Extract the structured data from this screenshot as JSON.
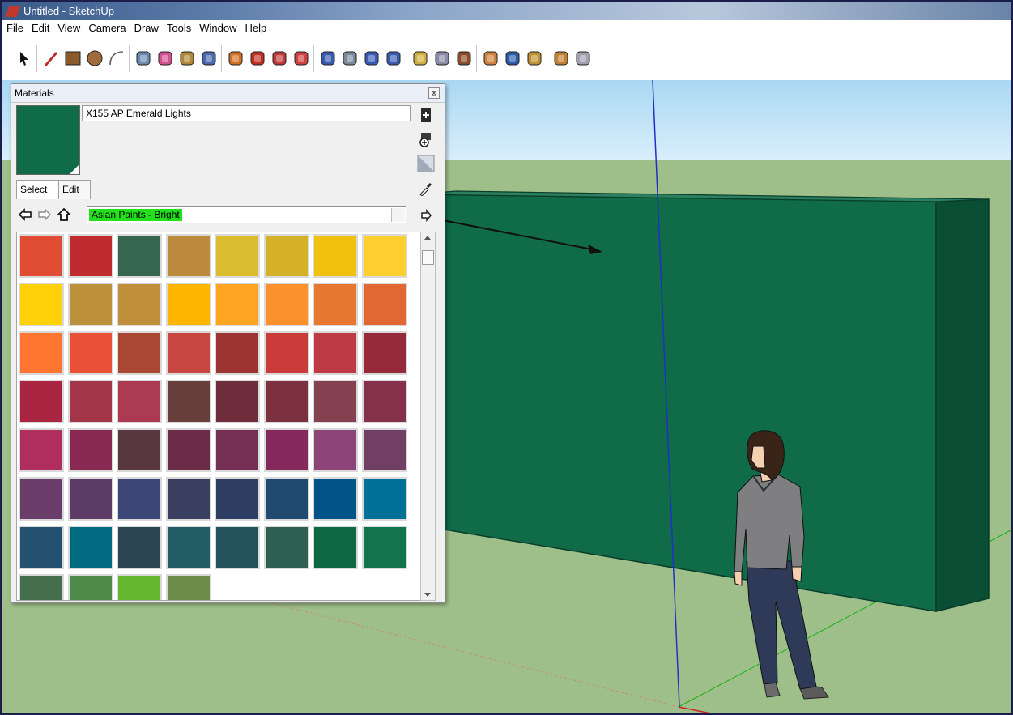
{
  "window": {
    "title": "Untitled - SketchUp"
  },
  "menu": [
    "File",
    "Edit",
    "View",
    "Camera",
    "Draw",
    "Tools",
    "Window",
    "Help"
  ],
  "toolbar": {
    "tools": [
      "select-arrow-icon",
      "pencil-icon",
      "rectangle-icon",
      "circle-icon",
      "arc-icon",
      "make-component-icon",
      "eraser-icon",
      "tape-measure-icon",
      "paint-bucket-icon",
      "push-pull-icon",
      "move-icon",
      "rotate-icon",
      "follow-me-icon",
      "orbit-icon",
      "pan-icon",
      "zoom-icon",
      "zoom-extents-icon",
      "get-models-icon",
      "share-model-icon",
      "components-icon",
      "add-location-icon",
      "google-earth-icon",
      "styles-icon",
      "share-component-icon",
      "photo-textures-icon"
    ],
    "colors": [
      "#303030",
      "#c02828",
      "#8b5a2b",
      "#a06a3a",
      "#606060",
      "#6a8ab0",
      "#d05090",
      "#b08838",
      "#4a6ab0",
      "#d07020",
      "#c03020",
      "#c03838",
      "#d04040",
      "#3a5ab0",
      "#7a8a9a",
      "#3a5ab8",
      "#3a5ab0",
      "#d0b040",
      "#8a8aa8",
      "#8b4a2a",
      "#d08040",
      "#2a5aa8",
      "#c09030",
      "#c08030",
      "#a0a0b0"
    ]
  },
  "materials": {
    "title": "Materials",
    "close_icon": "close-icon",
    "current_name": "X155 AP Emerald Lights",
    "current_color": "#0f6b48",
    "tabs": [
      "Select",
      "Edit"
    ],
    "collection": "Asian Paints - Bright",
    "nav_icons": [
      "back-arrow-icon",
      "forward-arrow-icon",
      "home-icon"
    ],
    "side_icons": [
      "create-material-icon",
      "display-secondary-pane-icon",
      "default-material-icon",
      "sample-paint-eyedropper-icon",
      "details-arrow-icon"
    ],
    "swatches": [
      [
        "#e04c34",
        "#bf2b2e",
        "#366650",
        "#bc8b3e",
        "#dbbc2e",
        "#d4b126",
        "#f0c20f",
        "#fed02f"
      ],
      [
        "#fed109",
        "#bd903c",
        "#c08f3c",
        "#feb500",
        "#fea420",
        "#fc902b",
        "#e77731",
        "#e16733"
      ],
      [
        "#fe7632",
        "#e95035",
        "#a94733",
        "#c84640",
        "#9c3532",
        "#c93c3a",
        "#be3b46",
        "#952a3b"
      ],
      [
        "#a92541",
        "#a33649",
        "#ab3a52",
        "#683e3d",
        "#6e2e3b",
        "#7c3140",
        "#854150",
        "#86314c"
      ],
      [
        "#b02e5e",
        "#892a52",
        "#58383f",
        "#6a2c46",
        "#742f54",
        "#85295c",
        "#8d4478",
        "#703f63"
      ],
      [
        "#6b3d6a",
        "#5c3c67",
        "#3c4778",
        "#3b3f5f",
        "#2e3f63",
        "#204a70",
        "#005488",
        "#007196"
      ],
      [
        "#245170",
        "#006a80",
        "#2c4553",
        "#245c66",
        "#22525b",
        "#2d6050",
        "#0e6844",
        "#12744a"
      ],
      [
        "#456e4d",
        "#508b4b",
        "#65b72f",
        "#6c8d49"
      ]
    ]
  }
}
